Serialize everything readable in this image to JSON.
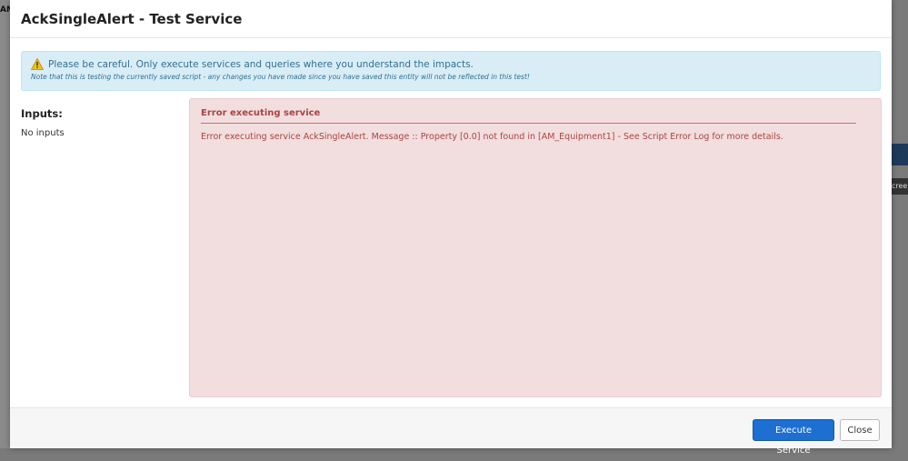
{
  "background": {
    "top_text": "AM",
    "right_fragment": "cree"
  },
  "modal": {
    "title": "AckSingleAlert - Test Service",
    "notice": {
      "icon": "warning-icon",
      "main": "Please be careful. Only execute services and queries where you understand the impacts.",
      "sub": "Note that this is testing the currently saved script - any changes you have made since you have saved this entity will not be reflected in this test!"
    },
    "inputs": {
      "label": "Inputs:",
      "empty": "No inputs"
    },
    "error": {
      "title": "Error executing service",
      "message": "Error executing service AckSingleAlert. Message :: Property [0.0] not found in [AM_Equipment1] - See Script Error Log for more details."
    },
    "footer": {
      "execute_label": "Execute Service",
      "close_label": "Close"
    }
  },
  "colors": {
    "info_bg": "#d9edf7",
    "info_text": "#31708f",
    "error_bg": "#f2dede",
    "error_text": "#a94442",
    "primary": "#1d6fd2"
  }
}
